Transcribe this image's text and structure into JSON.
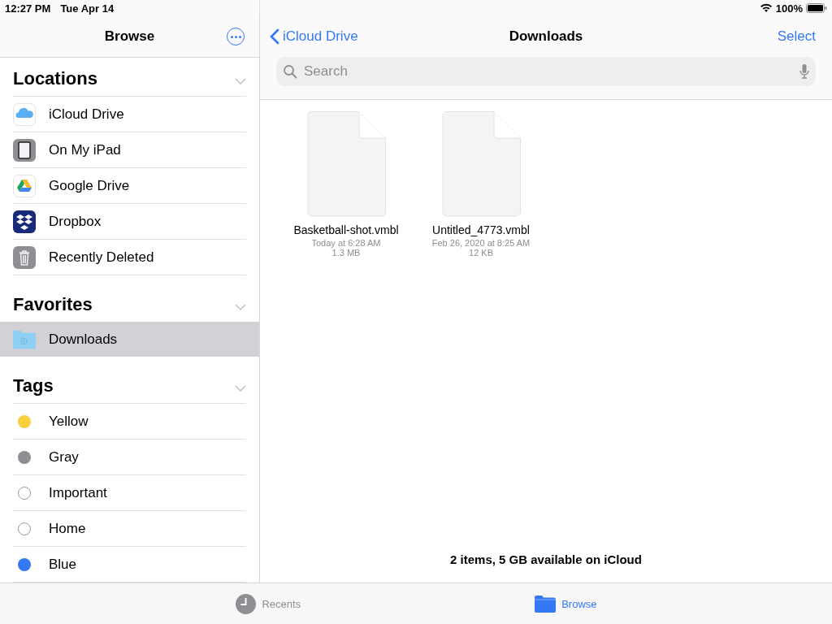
{
  "status_bar": {
    "time": "12:27 PM",
    "date": "Tue Apr 14",
    "battery": "100%"
  },
  "sidebar": {
    "title": "Browse",
    "sections": [
      {
        "title": "Locations",
        "expanded": true,
        "items": [
          {
            "kind": "icloud",
            "label": "iCloud Drive",
            "selected": false
          },
          {
            "kind": "ipad",
            "label": "On My iPad",
            "selected": false
          },
          {
            "kind": "gdrive",
            "label": "Google Drive",
            "selected": false
          },
          {
            "kind": "dropbox",
            "label": "Dropbox",
            "selected": false
          },
          {
            "kind": "trash",
            "label": "Recently Deleted",
            "selected": false
          }
        ]
      },
      {
        "title": "Favorites",
        "expanded": true,
        "items": [
          {
            "kind": "folder",
            "label": "Downloads",
            "selected": true
          }
        ]
      },
      {
        "title": "Tags",
        "expanded": true,
        "items": [
          {
            "kind": "tag",
            "label": "Yellow",
            "color": "#f8cf3f",
            "selected": false
          },
          {
            "kind": "tag",
            "label": "Gray",
            "color": "#8e8e93",
            "selected": false
          },
          {
            "kind": "tag-outline",
            "label": "Important",
            "selected": false
          },
          {
            "kind": "tag-outline",
            "label": "Home",
            "selected": false
          },
          {
            "kind": "tag",
            "label": "Blue",
            "color": "#3478f6",
            "selected": false
          }
        ]
      }
    ]
  },
  "main": {
    "back": "iCloud Drive",
    "title": "Downloads",
    "action": "Select",
    "search": {
      "placeholder": "Search"
    },
    "files": [
      {
        "name": "Basketball-shot.vmbl",
        "date": "Today at 6:28 AM",
        "size": "1.3 MB"
      },
      {
        "name": "Untitled_4773.vmbl",
        "date": "Feb 26, 2020 at 8:25 AM",
        "size": "12 KB"
      }
    ],
    "footer": "2 items, 5 GB available on iCloud"
  },
  "tab_bar": [
    {
      "kind": "recents",
      "label": "Recents",
      "selected": false
    },
    {
      "kind": "browse",
      "label": "Browse",
      "selected": true
    }
  ]
}
